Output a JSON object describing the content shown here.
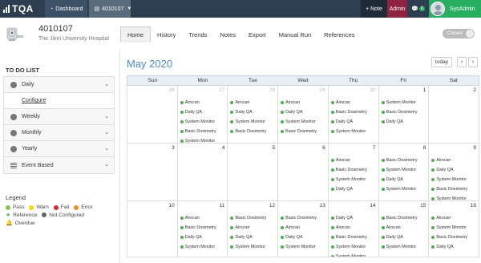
{
  "topbar": {
    "logo": "TQA",
    "dashboard": "Dashboard",
    "machine_selector": "4010107",
    "note_label": "+ Note",
    "admin_label": "Admin",
    "message_count": "0",
    "user_name": "SysAdmin"
  },
  "header": {
    "machine_id": "4010107",
    "hospital": "The Jikei University Hospital",
    "tabs": [
      {
        "label": "Home",
        "active": true
      },
      {
        "label": "History"
      },
      {
        "label": "Trends"
      },
      {
        "label": "Notes"
      },
      {
        "label": "Export"
      },
      {
        "label": "Manual Run"
      },
      {
        "label": "References"
      }
    ],
    "closed_toggle": "Closed"
  },
  "sidebar": {
    "todo_title": "TO DO LIST",
    "items": [
      {
        "label": "Daily"
      },
      {
        "label": "Configure"
      },
      {
        "label": "Weekly"
      },
      {
        "label": "Monthly"
      },
      {
        "label": "Yearly"
      },
      {
        "label": "Event Based"
      }
    ],
    "legend_title": "Legend",
    "legend": [
      {
        "label": "Pass",
        "color": "#8bc34a"
      },
      {
        "label": "Warn",
        "color": "#f5d90a"
      },
      {
        "label": "Fail",
        "color": "#d62b2b"
      },
      {
        "label": "Error",
        "color": "#f08a24"
      },
      {
        "label": "Reference",
        "color": "#4caf50",
        "icon": "star-icon"
      },
      {
        "label": "Not Configured",
        "color": "#666666"
      },
      {
        "label": "Overdue",
        "color": "#666666",
        "icon": "bell-icon"
      }
    ]
  },
  "calendar": {
    "title": "May 2020",
    "today_label": "today",
    "prev_icon": "chevron-left-icon",
    "next_icon": "chevron-right-icon",
    "days": [
      "Sun",
      "Mon",
      "Tue",
      "Wed",
      "Thu",
      "Fri",
      "Sat"
    ],
    "weeks": [
      [
        {
          "num": "26",
          "muted": true,
          "events": []
        },
        {
          "num": "27",
          "muted": true,
          "events": [
            "Airscan",
            "Daily QA",
            "System Monitor",
            "Basic Dosimetry",
            "System Monitor"
          ]
        },
        {
          "num": "28",
          "muted": true,
          "events": [
            "Airscan",
            "Daily QA",
            "System Monitor",
            "Basic Dosimetry"
          ]
        },
        {
          "num": "29",
          "muted": true,
          "events": [
            "Airscan",
            "Daily QA",
            "System Monitor",
            "Basic Dosimetry"
          ]
        },
        {
          "num": "30",
          "muted": true,
          "events": [
            "Airscan",
            "Basic Dosimetry",
            "Daily QA",
            "System Monitor"
          ]
        },
        {
          "num": "1",
          "events": [
            "System Monitor",
            "Basic Dosimetry",
            "Daily QA"
          ]
        },
        {
          "num": "2",
          "events": []
        }
      ],
      [
        {
          "num": "3",
          "events": []
        },
        {
          "num": "4",
          "events": []
        },
        {
          "num": "5",
          "events": []
        },
        {
          "num": "6",
          "events": []
        },
        {
          "num": "7",
          "events": [
            "Airscan",
            "Basic Dosimetry",
            "System Monitor",
            "Daily QA"
          ]
        },
        {
          "num": "8",
          "events": [
            "Basic Dosimetry",
            "System Monitor",
            "Daily QA",
            "System Monitor"
          ]
        },
        {
          "num": "9",
          "events": [
            "Airscan",
            "Daily QA",
            "System Monitor",
            "Basic Dosimetry",
            "System Monitor"
          ]
        }
      ],
      [
        {
          "num": "10",
          "events": []
        },
        {
          "num": "11",
          "events": [
            "Airscan",
            "Basic Dosimetry",
            "Daily QA",
            "System Monitor"
          ]
        },
        {
          "num": "12",
          "events": [
            "Basic Dosimetry",
            "Airscan",
            "Daily QA",
            "System Monitor"
          ]
        },
        {
          "num": "13",
          "events": [
            "Basic Dosimetry",
            "Airscan",
            "Daily QA",
            "System Monitor"
          ]
        },
        {
          "num": "14",
          "events": [
            "Daily QA",
            "Airscan",
            "Basic Dosimetry",
            "System Monitor",
            "System Monitor"
          ]
        },
        {
          "num": "15",
          "events": [
            "Basic Dosimetry",
            "Airscan",
            "Daily QA",
            "System Monitor"
          ]
        },
        {
          "num": "16",
          "events": [
            "Airscan",
            "System Monitor",
            "Basic Dosimetry",
            "Daily QA"
          ]
        }
      ]
    ]
  }
}
